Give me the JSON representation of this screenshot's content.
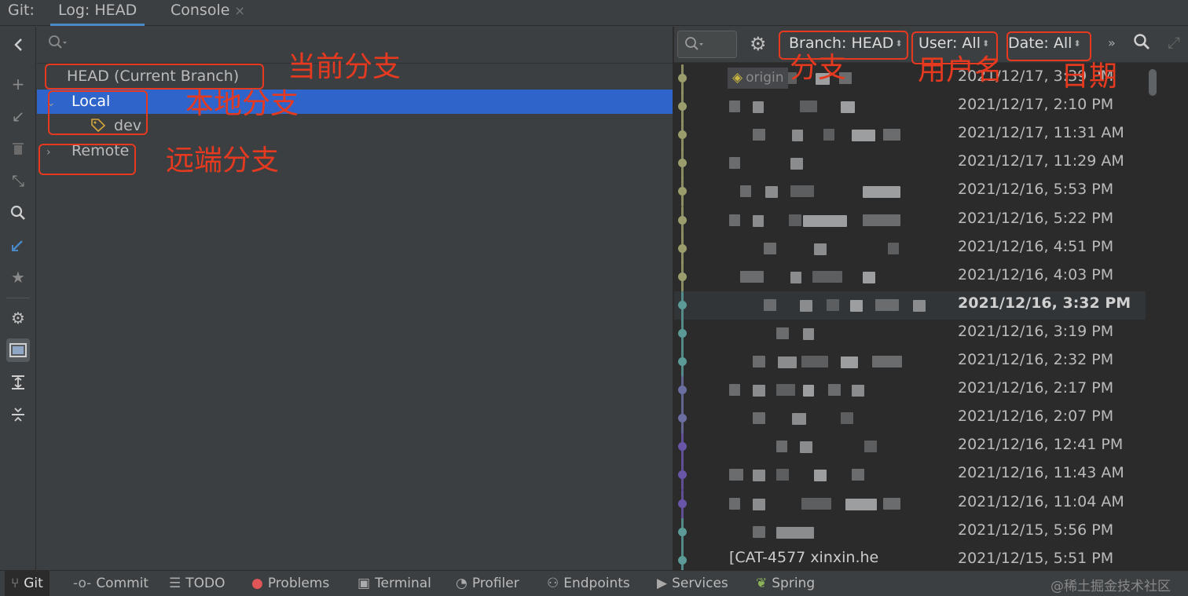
{
  "tabs": {
    "prefix": "Git:",
    "log": "Log: HEAD",
    "console": "Console",
    "close_glyph": "×"
  },
  "left_toolbar": {
    "icons": [
      "collapse-arrow-icon",
      "add-icon",
      "checkout-icon",
      "delete-icon",
      "merge-icon",
      "search-icon",
      "edit-icon",
      "favorite-icon",
      "settings-icon",
      "panel-toggle-icon",
      "expand-all-icon",
      "collapse-all-icon"
    ]
  },
  "branches": {
    "head": "HEAD (Current Branch)",
    "local": "Local",
    "local_branch": "dev",
    "remote": "Remote",
    "search_icon": "search-icon"
  },
  "log_toolbar": {
    "branch_filter": "Branch: HEAD",
    "user_filter": "User: All",
    "date_filter": "Date: All",
    "more_glyph": "»"
  },
  "commits": [
    {
      "date": "2021/12/17, 3:39 PM",
      "ref": "origin",
      "color": "#9c9d6c"
    },
    {
      "date": "2021/12/17, 2:10 PM",
      "color": "#9c9d6c"
    },
    {
      "date": "2021/12/17, 11:31 AM",
      "color": "#9c9d6c"
    },
    {
      "date": "2021/12/17, 11:29 AM",
      "color": "#9c9d6c"
    },
    {
      "date": "2021/12/16, 5:53 PM",
      "color": "#9c9d6c"
    },
    {
      "date": "2021/12/16, 5:22 PM",
      "color": "#9c9d6c"
    },
    {
      "date": "2021/12/16, 4:51 PM",
      "color": "#9c9d6c"
    },
    {
      "date": "2021/12/16, 4:03 PM",
      "color": "#9c9d6c"
    },
    {
      "date": "2021/12/16, 3:32 PM",
      "color": "#5b9a96",
      "current": true
    },
    {
      "date": "2021/12/16, 3:19 PM",
      "color": "#5b9a96"
    },
    {
      "date": "2021/12/16, 2:32 PM",
      "color": "#5b9a96"
    },
    {
      "date": "2021/12/16, 2:17 PM",
      "color": "#6b6ea0"
    },
    {
      "date": "2021/12/16, 2:07 PM",
      "color": "#6b6ea0"
    },
    {
      "date": "2021/12/16, 12:41 PM",
      "color": "#6a56a8"
    },
    {
      "date": "2021/12/16, 11:43 AM",
      "color": "#6a56a8"
    },
    {
      "date": "2021/12/16, 11:04 AM",
      "color": "#6a56a8"
    },
    {
      "date": "2021/12/15, 5:56 PM",
      "color": "#5b9a96"
    },
    {
      "date": "2021/12/15, 5:51 PM",
      "color": "#5b9a96",
      "message": "[CAT-4577 xinxin.he"
    }
  ],
  "annotations": {
    "current_branch": "当前分支",
    "local_branch": "本地分支",
    "remote_branch": "远端分支",
    "branch": "分支",
    "username": "用户名",
    "date": "日期"
  },
  "bottom_bar": {
    "items": [
      "Git",
      "Commit",
      "TODO",
      "Problems",
      "Terminal",
      "Profiler",
      "Endpoints",
      "Services",
      "Spring"
    ],
    "watermark": "@稀土掘金技术社区"
  },
  "colors": {
    "selection": "#2f65ca",
    "annotation": "#e53a20",
    "tab_underline": "#4a88c7"
  }
}
